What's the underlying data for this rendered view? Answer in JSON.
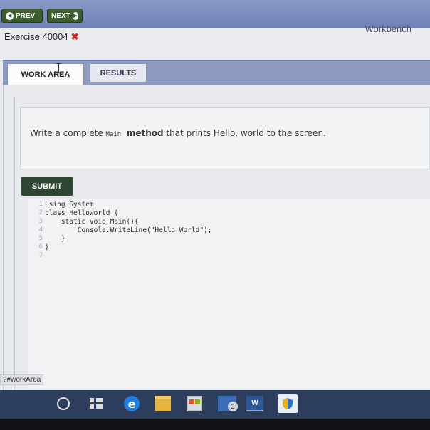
{
  "nav": {
    "prev_label": "PREV",
    "next_label": "NEXT"
  },
  "header": {
    "brand": "Workbench",
    "exercise_label": "Exercise 40004",
    "exercise_status_mark": "✖"
  },
  "tabs": [
    {
      "label": "WORK AREA",
      "active": true
    },
    {
      "label": "RESULTS",
      "active": false
    }
  ],
  "prompt": {
    "before": "Write a complete ",
    "code": "Main",
    "bold": "method",
    "after": " that prints Hello, world to the screen."
  },
  "submit_label": "SUBMIT",
  "editor": {
    "line_numbers": [
      "1",
      "2",
      "3",
      "4",
      "5",
      "6",
      "7"
    ],
    "lines": [
      "using System",
      "class Helloworld {",
      "    static void Main(){",
      "        Console.WriteLine(\"Hello World\");",
      "    }",
      "}",
      ""
    ]
  },
  "status_url": "?#workArea",
  "taskbar": {
    "mail_badge": "2",
    "word_label": "W",
    "edge_label": "e",
    "icons": [
      "search-icon",
      "task-view-icon",
      "edge-icon",
      "file-explorer-icon",
      "store-icon",
      "mail-icon",
      "word-icon",
      "security-shield-icon"
    ]
  },
  "colors": {
    "accent_blue": "#6f80b4",
    "nav_green": "#3d5d2c",
    "submit_green": "#2f4632",
    "error_red": "#cc2a1b"
  }
}
